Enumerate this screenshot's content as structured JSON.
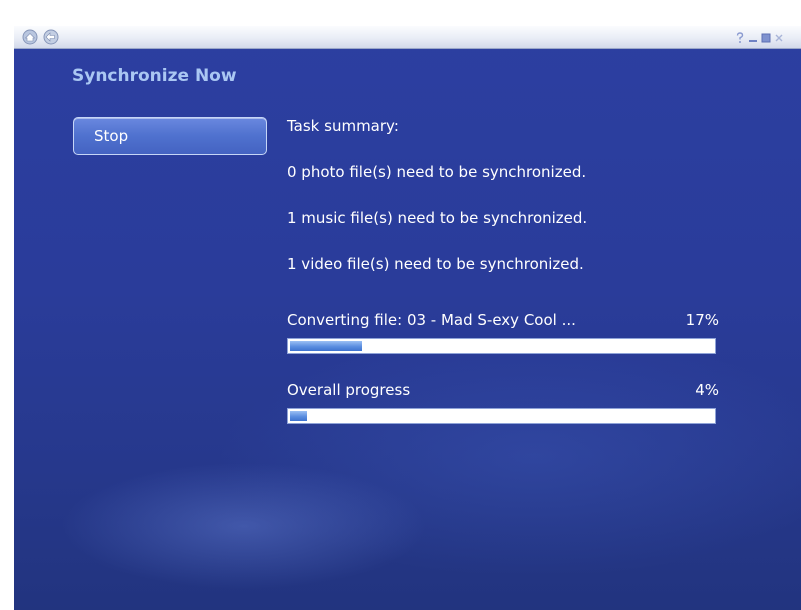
{
  "titlebar": {
    "icons": [
      "home-icon",
      "back-arrow-icon"
    ],
    "window_controls": [
      "help-icon",
      "minimize-icon",
      "restore-icon",
      "close-icon"
    ]
  },
  "page": {
    "heading": "Synchronize Now",
    "stop_label": "Stop"
  },
  "summary": {
    "title": "Task summary:",
    "lines": [
      "0 photo file(s) need to be synchronized.",
      "1 music file(s) need to be synchronized.",
      "1 video file(s) need to be synchronized."
    ]
  },
  "progress": {
    "file": {
      "label": "Converting file: 03 - Mad S-exy Cool ...",
      "percent_text": "17%",
      "percent": 17
    },
    "overall": {
      "label": "Overall progress",
      "percent_text": "4%",
      "percent": 4
    }
  },
  "colors": {
    "background": "#2a3c9a",
    "heading": "#aac7f3",
    "bar_fill": "#5b8ee0"
  }
}
